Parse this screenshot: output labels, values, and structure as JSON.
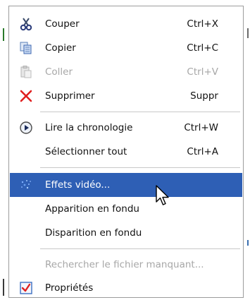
{
  "menu": {
    "items": [
      {
        "label": "Couper",
        "shortcut": "Ctrl+X",
        "icon": "scissors-icon"
      },
      {
        "label": "Copier",
        "shortcut": "Ctrl+C",
        "icon": "copy-icon"
      },
      {
        "label": "Coller",
        "shortcut": "Ctrl+V",
        "icon": "paste-icon",
        "disabled": true
      },
      {
        "label": "Supprimer",
        "shortcut": "Suppr",
        "icon": "delete-x-icon"
      },
      {
        "label": "Lire la chronologie",
        "shortcut": "Ctrl+W",
        "icon": "play-circle-icon"
      },
      {
        "label": "Sélectionner tout",
        "shortcut": "Ctrl+A"
      },
      {
        "label": "Effets vidéo...",
        "icon": "video-effects-icon",
        "highlighted": true
      },
      {
        "label": "Apparition en fondu"
      },
      {
        "label": "Disparition en fondu"
      },
      {
        "label": "Rechercher le fichier manquant...",
        "disabled": true
      },
      {
        "label": "Propriétés",
        "icon": "properties-check-icon"
      }
    ]
  },
  "colors": {
    "highlight": "#2e5fb5",
    "disabled_text": "#a7a7a7",
    "delete_red": "#e02020"
  }
}
